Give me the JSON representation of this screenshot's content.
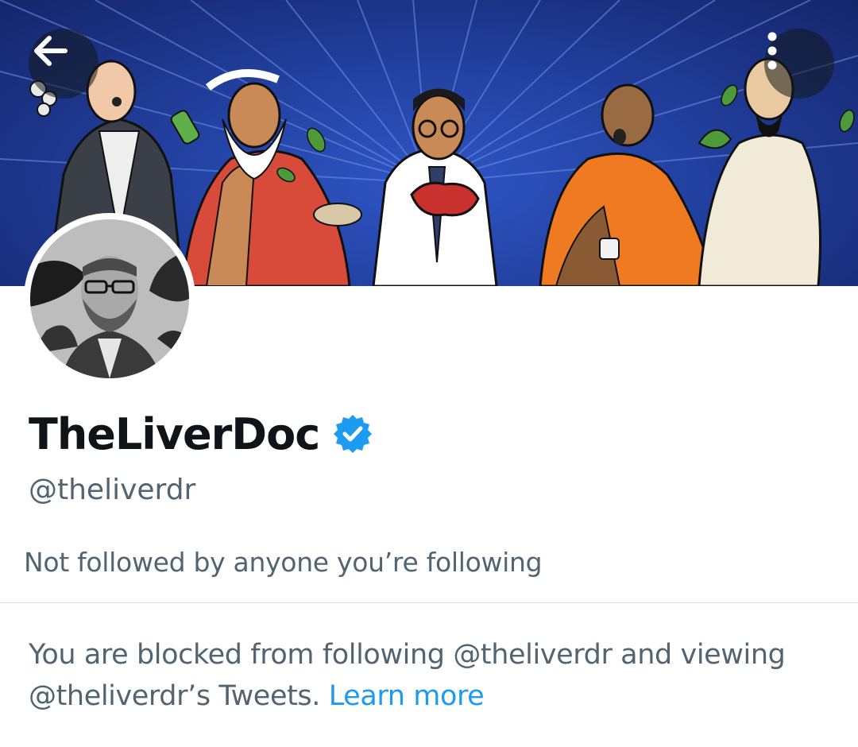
{
  "banner": {
    "alt_theme": "Illustrated banner: doctor holding a liver surrounded by traditional healers",
    "colors": {
      "background": "#22409f",
      "rays": "#6f8fe8"
    }
  },
  "nav": {
    "back_icon": "arrow-left-icon",
    "more_icon": "more-vertical-icon"
  },
  "profile": {
    "display_name": "TheLiverDoc",
    "verified_icon": "verified-badge-icon",
    "verified_color": "#1d9bf0",
    "handle": "@theliverdr",
    "followers_note": "Not followed by anyone you’re following"
  },
  "blocked": {
    "message": "You are blocked from following @theliverdr and viewing @theliverdr’s Tweets.",
    "learn_more": "Learn more"
  },
  "colors": {
    "text_primary": "#0f1419",
    "text_secondary": "#536471",
    "link": "#1d9bf0",
    "divider": "#cfe3e6"
  }
}
